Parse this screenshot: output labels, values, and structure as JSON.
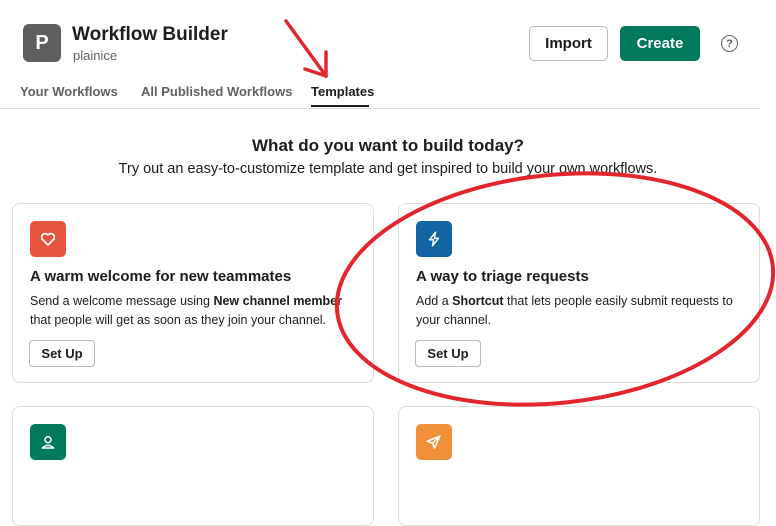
{
  "header": {
    "avatar_letter": "P",
    "app_title": "Workflow Builder",
    "workspace": "plainice",
    "import_label": "Import",
    "create_label": "Create",
    "help_glyph": "?"
  },
  "tabs": [
    {
      "label": "Your Workflows",
      "active": false
    },
    {
      "label": "All Published Workflows",
      "active": false
    },
    {
      "label": "Templates",
      "active": true
    }
  ],
  "intro": {
    "headline": "What do you want to build today?",
    "subline": "Try out an easy-to-customize template and get inspired to build your own workflows."
  },
  "cards": [
    {
      "icon": "heart-icon",
      "icon_color": "#e8553e",
      "title": "A warm welcome for new teammates",
      "desc_pre": "Send a welcome message using ",
      "desc_bold": "New channel member",
      "desc_post": " that people will get as soon as they join your channel.",
      "button": "Set Up"
    },
    {
      "icon": "lightning-icon",
      "icon_color": "#1264a3",
      "title": "A way to triage requests",
      "desc_pre": "Add a ",
      "desc_bold": "Shortcut",
      "desc_post": " that lets people easily submit requests to your channel.",
      "button": "Set Up"
    },
    {
      "icon": "person-icon",
      "icon_color": "#007a5a"
    },
    {
      "icon": "paper-plane-icon",
      "icon_color": "#f0913a"
    }
  ],
  "colors": {
    "accent": "#007a5a",
    "annotation": "#e3262d"
  }
}
